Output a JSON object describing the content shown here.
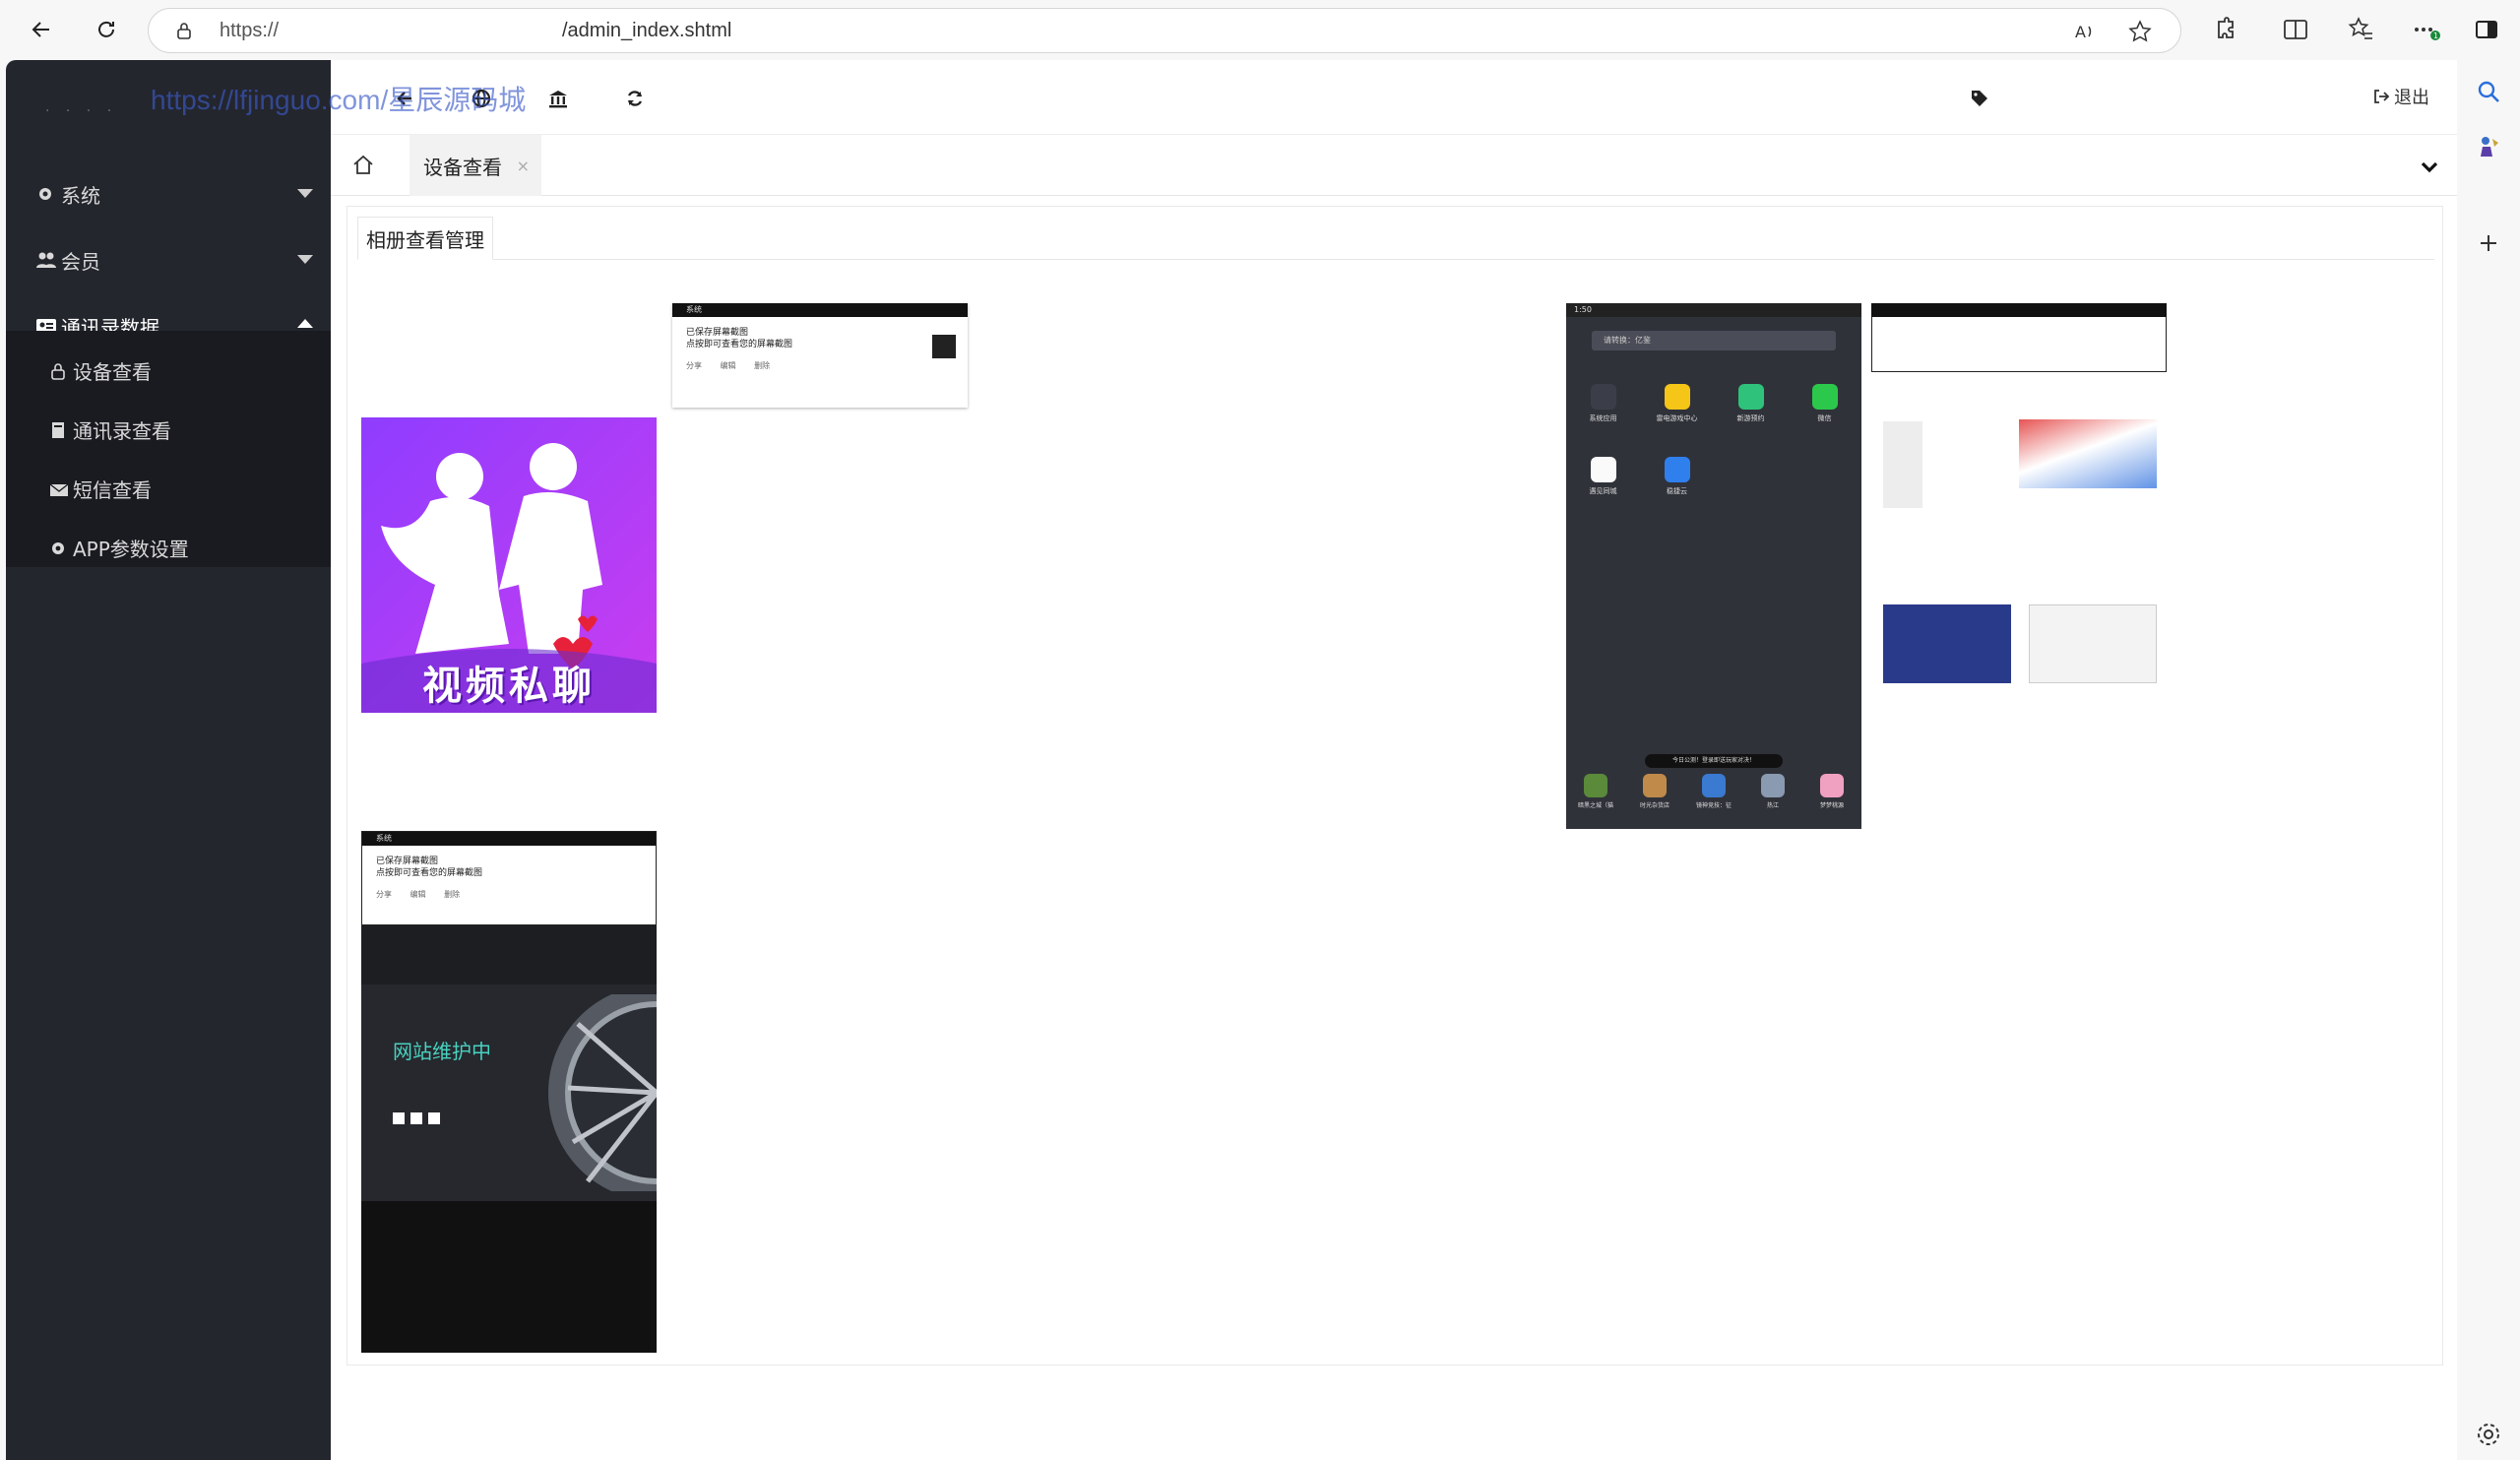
{
  "browser": {
    "url_prefix": "https://",
    "url_path": "/admin_index.shtml"
  },
  "sidebar": {
    "logo_text": "· · · ·",
    "menu": [
      {
        "label": "系统",
        "icon": "gear-icon",
        "expanded": false
      },
      {
        "label": "会员",
        "icon": "users-icon",
        "expanded": false
      },
      {
        "label": "通讯录数据",
        "icon": "id-card-icon",
        "expanded": true
      }
    ],
    "submenu": [
      {
        "label": "设备查看",
        "icon": "lock-icon"
      },
      {
        "label": "通讯录查看",
        "icon": "book-icon"
      },
      {
        "label": "短信查看",
        "icon": "envelope-icon"
      },
      {
        "label": "APP参数设置",
        "icon": "gear-icon"
      }
    ]
  },
  "header": {
    "logout_label": "退出"
  },
  "tabs": {
    "active_label": "设备查看",
    "close_glyph": "×"
  },
  "panel": {
    "tab_label": "相册查看管理"
  },
  "watermark": "https://lfjinguo.com/星辰源码城",
  "photos": {
    "notif_title": "已保存屏幕截图",
    "notif_sub": "点按即可查看您的屏幕截图",
    "notif_actions": "分享 编辑 删除",
    "status_label": "系统",
    "app_banner_text": "视频私聊",
    "maintenance_title": "网站维护中",
    "phone_time": "1:50",
    "phone_search": "请转换：亿鉴",
    "phone_toast": "今日公测！登录即送玩家对决！",
    "apps_row1": [
      "系统应用",
      "雷电游戏中心",
      "新游预约",
      "微信"
    ],
    "apps_row2": [
      "遇见同城",
      "稳捷云"
    ],
    "dock": [
      "暗黑之城（猫",
      "时光杂货店",
      "镜神竞技：征",
      "热江",
      "梦梦桃源"
    ]
  }
}
